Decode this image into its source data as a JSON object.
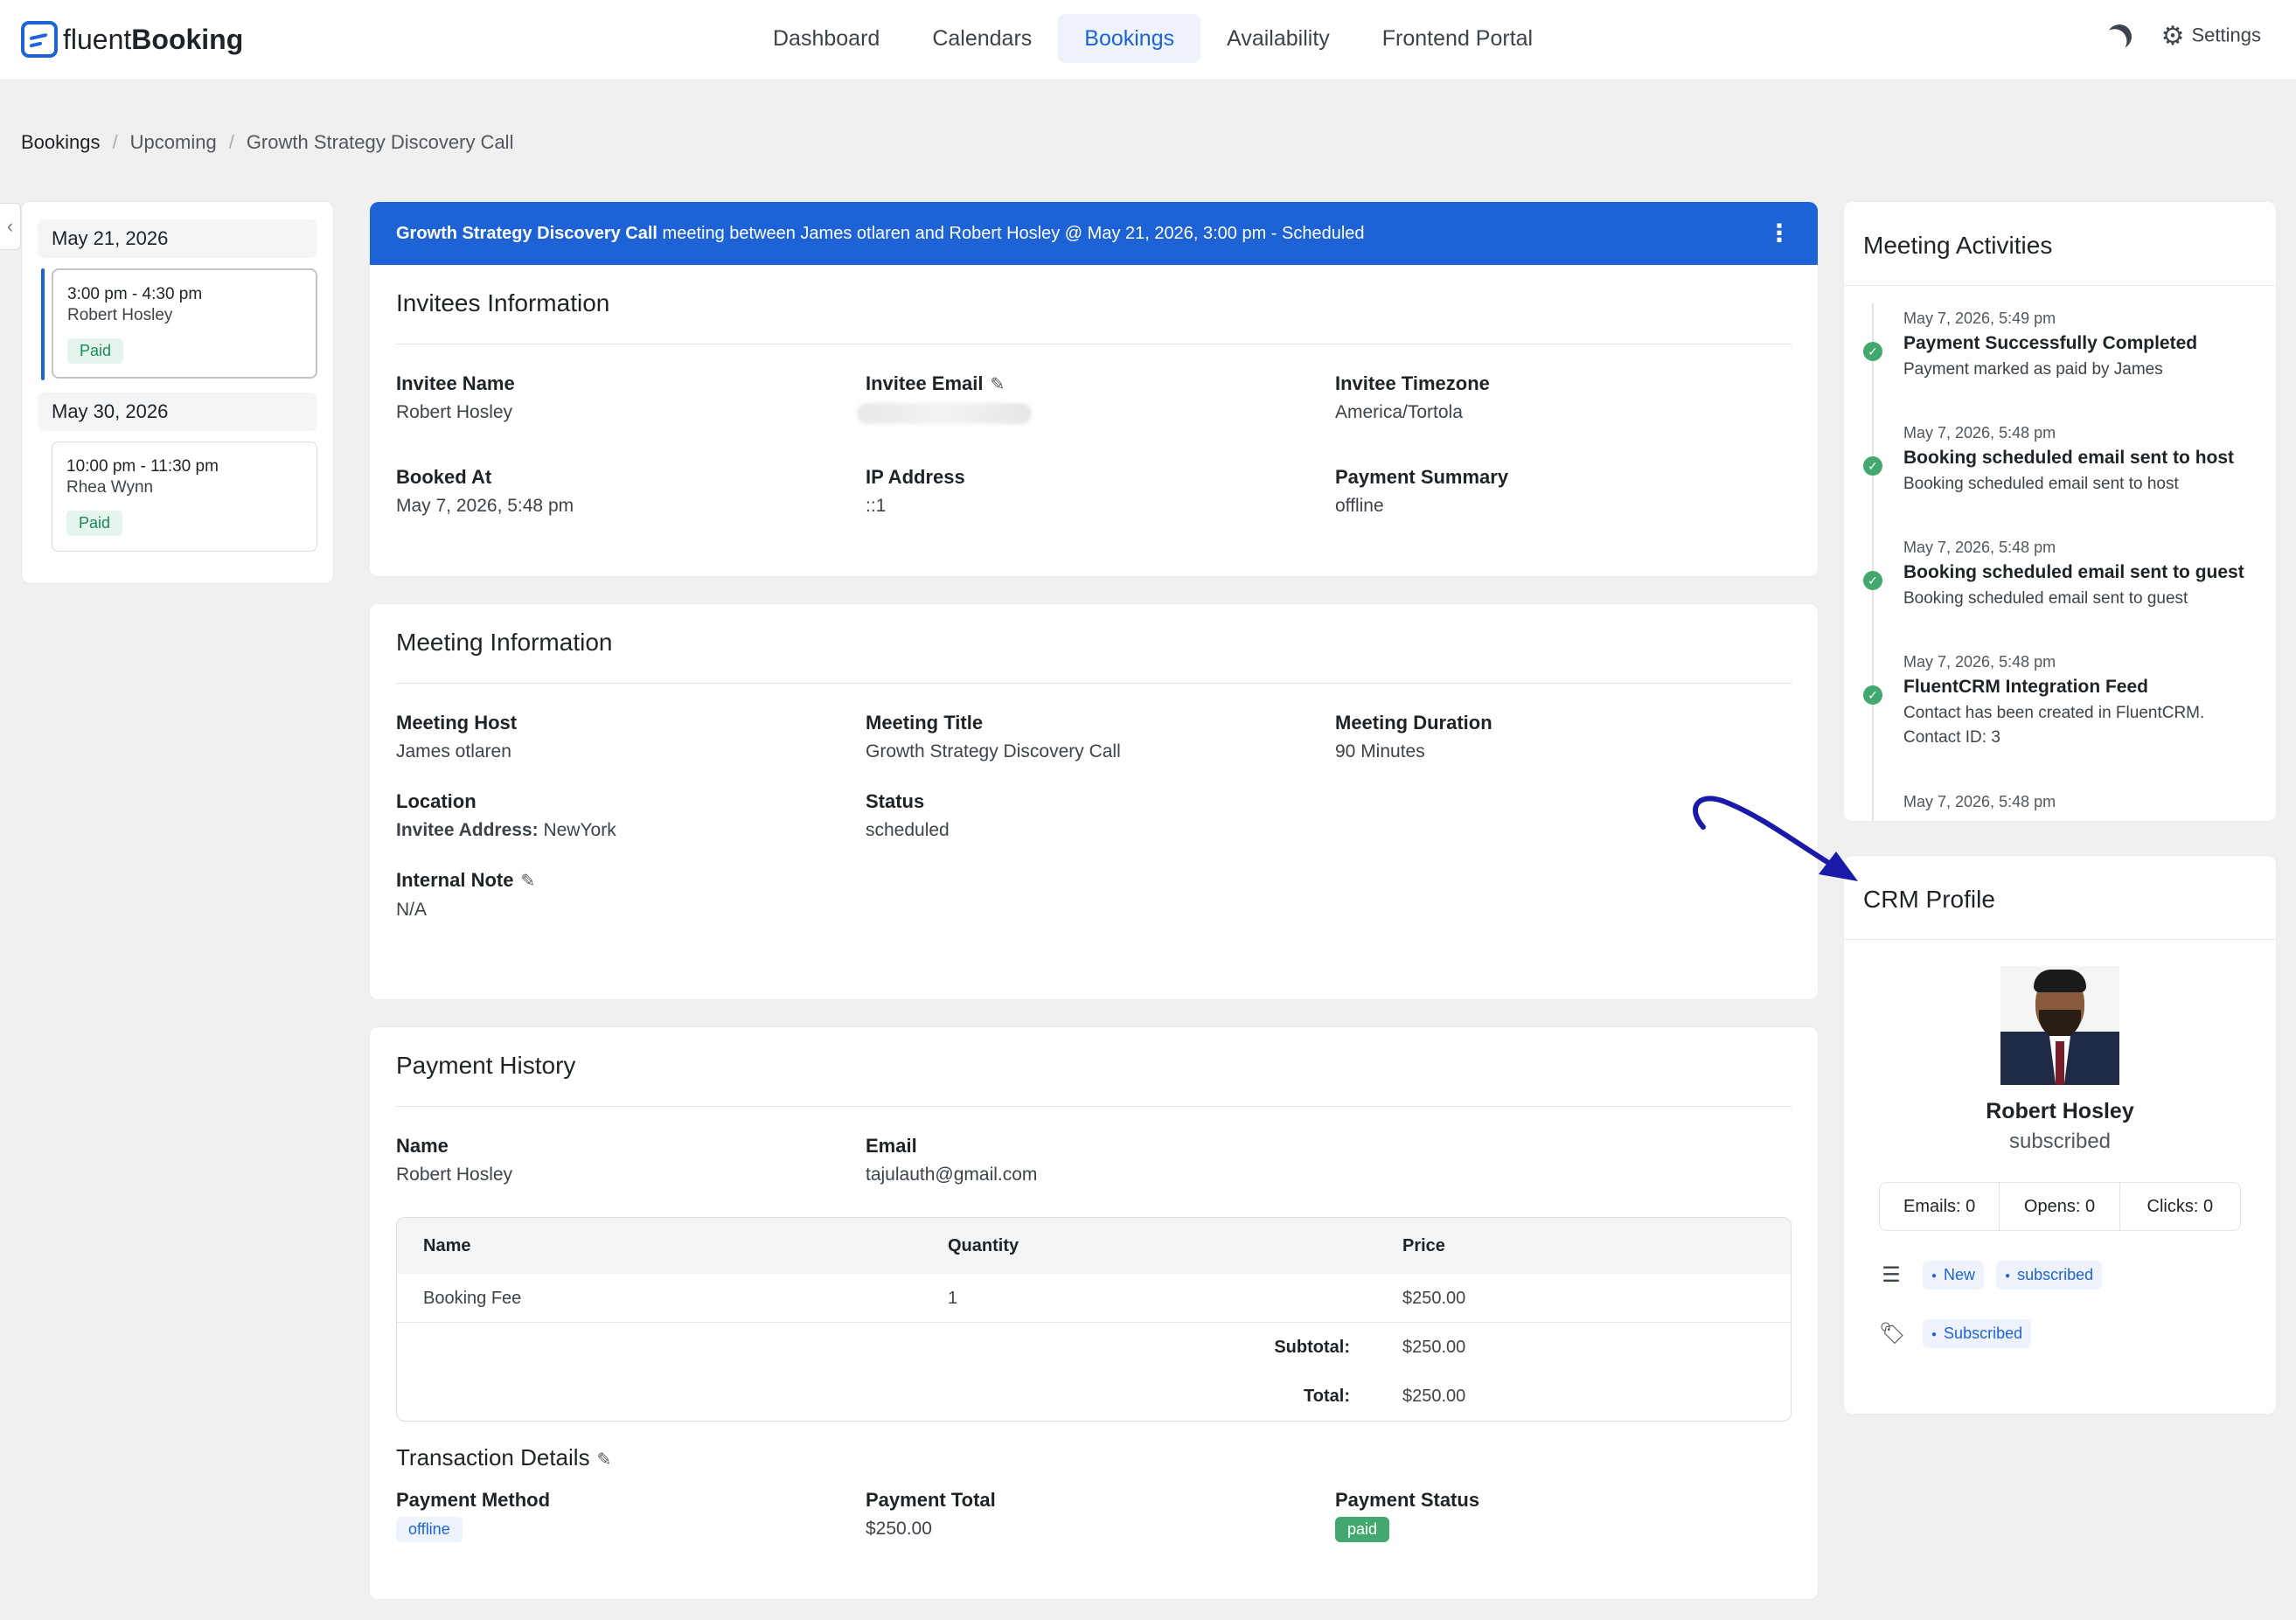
{
  "app": {
    "logo_prefix": "fluent",
    "logo_suffix": "Booking"
  },
  "nav": {
    "items": [
      "Dashboard",
      "Calendars",
      "Bookings",
      "Availability",
      "Frontend Portal"
    ],
    "active": "Bookings",
    "settings_label": "Settings"
  },
  "breadcrumb": [
    "Bookings",
    "Upcoming",
    "Growth Strategy Discovery Call"
  ],
  "sidebar": {
    "groups": [
      {
        "date": "May 21, 2026",
        "time": "3:00 pm - 4:30 pm",
        "person": "Robert Hosley",
        "badge": "Paid"
      },
      {
        "date": "May 30, 2026",
        "time": "10:00 pm - 11:30 pm",
        "person": "Rhea Wynn",
        "badge": "Paid"
      }
    ]
  },
  "banner": {
    "event_name": "Growth Strategy Discovery Call",
    "text": " meeting between James otlaren and Robert Hosley @ May 21, 2026, 3:00 pm - Scheduled"
  },
  "invitees": {
    "title": "Invitees Information",
    "fields": [
      {
        "label": "Invitee Name",
        "value": "Robert Hosley"
      },
      {
        "label": "Invitee Email",
        "value": ""
      },
      {
        "label": "Invitee Timezone",
        "value": "America/Tortola"
      },
      {
        "label": "Booked At",
        "value": "May 7, 2026, 5:48 pm"
      },
      {
        "label": "IP Address",
        "value": "::1"
      },
      {
        "label": "Payment Summary",
        "value": "offline"
      }
    ]
  },
  "meeting": {
    "title": "Meeting Information",
    "host_label": "Meeting Host",
    "host": "James otlaren",
    "title_label": "Meeting Title",
    "meeting_title": "Growth Strategy Discovery Call",
    "duration_label": "Meeting Duration",
    "duration": "90 Minutes",
    "location_label": "Location",
    "location_key": "Invitee Address:",
    "location_value": " NewYork",
    "status_label": "Status",
    "status": "scheduled",
    "note_label": "Internal Note",
    "note": "N/A"
  },
  "payment": {
    "title": "Payment History",
    "name_label": "Name",
    "name": "Robert Hosley",
    "email_label": "Email",
    "email": "tajulauth@gmail.com",
    "table": {
      "headers": [
        "Name",
        "Quantity",
        "Price"
      ],
      "rows": [
        [
          "Booking Fee",
          "1",
          "$250.00"
        ]
      ],
      "subtotal_label": "Subtotal:",
      "subtotal": "$250.00",
      "total_label": "Total:",
      "total": "$250.00"
    },
    "transaction_title": "Transaction Details",
    "method_label": "Payment Method",
    "method": "offline",
    "total_label": "Payment Total",
    "total_value": "$250.00",
    "status_label": "Payment Status",
    "status": "paid"
  },
  "activities": {
    "title": "Meeting Activities",
    "items": [
      {
        "when": "May 7, 2026, 5:49 pm",
        "what": "Payment Successfully Completed",
        "desc": "Payment marked as paid by James"
      },
      {
        "when": "May 7, 2026, 5:48 pm",
        "what": "Booking scheduled email sent to host",
        "desc": "Booking scheduled email sent to host"
      },
      {
        "when": "May 7, 2026, 5:48 pm",
        "what": "Booking scheduled email sent to guest",
        "desc": "Booking scheduled email sent to guest"
      },
      {
        "when": "May 7, 2026, 5:48 pm",
        "what": "FluentCRM Integration Feed",
        "desc": "Contact has been created in FluentCRM. Contact ID: 3"
      },
      {
        "when": "May 7, 2026, 5:48 pm",
        "what": "",
        "desc": ""
      }
    ]
  },
  "crm": {
    "title": "CRM Profile",
    "name": "Robert Hosley",
    "status": "subscribed",
    "emails": "Emails: 0",
    "opens": "Opens: 0",
    "clicks": "Clicks: 0",
    "list_tags": [
      "New",
      "subscribed"
    ],
    "tag_tags": [
      "Subscribed"
    ]
  },
  "colors": {
    "accent": "#1e63d6",
    "success": "#42a86e",
    "annotation_arrow": "#1a1aa8"
  }
}
